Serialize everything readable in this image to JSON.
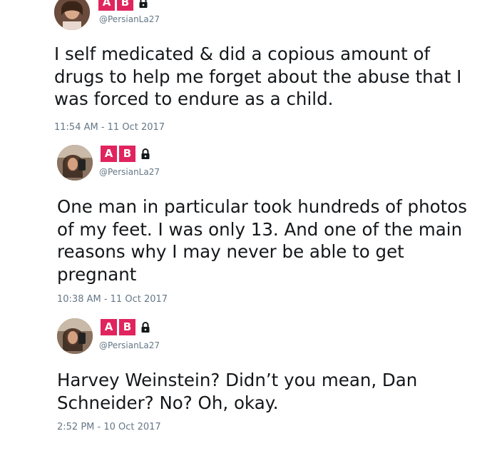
{
  "tweets": [
    {
      "badge_letters": [
        "A",
        "B"
      ],
      "handle": "@PersianLa27",
      "text": "I self medicated & did a copious amount of drugs to help me forget about the abuse that I was forced to endure as a child.",
      "timestamp": "11:54 AM - 11 Oct 2017"
    },
    {
      "badge_letters": [
        "A",
        "B"
      ],
      "handle": "@PersianLa27",
      "text": "One man in particular took hundreds of photos of my feet. I was only 13. And one of the main reasons why I may never be able to get pregnant",
      "timestamp": "10:38 AM - 11 Oct 2017"
    },
    {
      "badge_letters": [
        "A",
        "B"
      ],
      "handle": "@PersianLa27",
      "text": "Harvey Weinstein? Didn’t you mean, Dan Schneider? No? Oh, okay.",
      "timestamp": "2:52 PM - 10 Oct 2017"
    }
  ],
  "colors": {
    "badge": "#e0245e",
    "text": "#14171a",
    "secondary": "#657786"
  },
  "icons": {
    "lock": "lock-icon",
    "avatar": "avatar"
  }
}
